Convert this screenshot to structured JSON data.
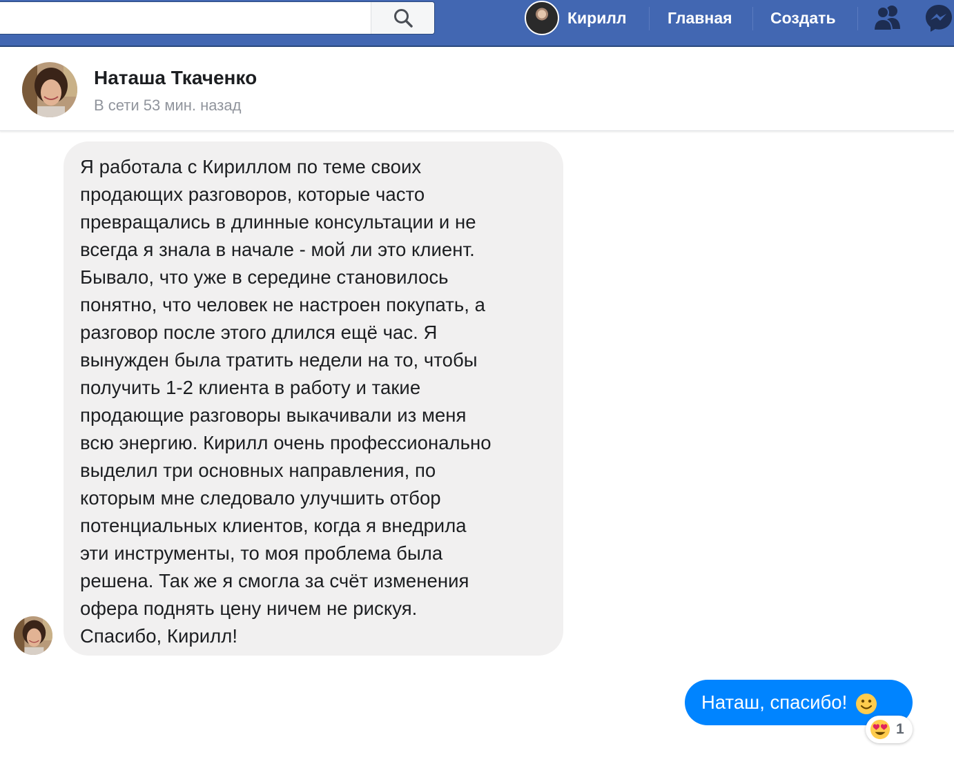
{
  "topbar": {
    "search": {
      "value": "",
      "placeholder": ""
    },
    "profile_name": "Кирилл",
    "home_label": "Главная",
    "create_label": "Создать",
    "friends_icon": "friends-icon",
    "messenger_icon": "messenger-icon",
    "accent_color": "#4267b2"
  },
  "conversation": {
    "contact_name": "Наташа Ткаченко",
    "status": "В сети 53 мин. назад"
  },
  "messages": {
    "incoming": {
      "lines": [
        "Я работала с Кириллом по теме своих",
        "продающих разговоров, которые часто",
        "превращались в длинные консультации и не",
        "всегда я знала в начале - мой ли это клиент.",
        "Бывало, что уже в середине становилось",
        "понятно, что человек не настроен покупать, а",
        "разговор после этого длился ещё час. Я",
        "вынужден была тратить недели на то, чтобы",
        "получить 1-2 клиента в работу и такие",
        "продающие разговоры выкачивали из меня",
        "всю энергию. Кирилл очень профессионально",
        "выделил три основных направления, по",
        "которым мне следовало улучшить отбор",
        "потенциальных клиентов, когда я внедрила",
        "эти инструменты, то моя проблема была",
        "решена. Так же я смогла за счёт изменения",
        "офера поднять цену ничем не рискуя.",
        "Спасибо, Кирилл!"
      ],
      "bubble_color": "#f1f0f0"
    },
    "outgoing": {
      "text": "Наташ, спасибо!",
      "emoji": "slightly-smiling-face-icon",
      "bubble_color": "#0084ff",
      "reaction": {
        "icon": "heart-eyes-emoji-icon",
        "count": "1"
      }
    }
  }
}
